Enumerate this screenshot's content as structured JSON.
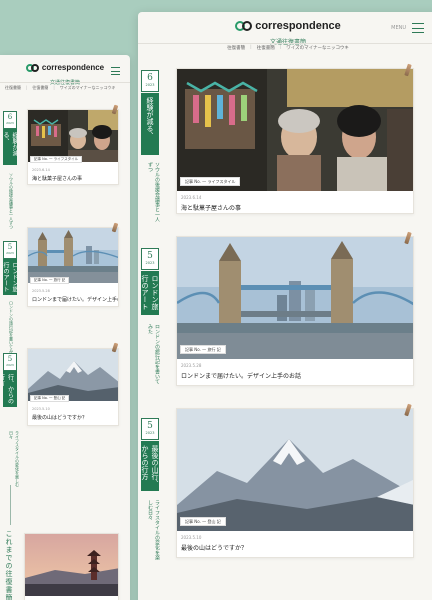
{
  "site": {
    "logo_text": "correspondence",
    "subtitle": "文通往復書簡",
    "menu_label": "MENU",
    "breadcrumb": [
      "往復書簡",
      "往復書簡",
      "ワイズのマイナーなニッコウキ"
    ]
  },
  "posts": [
    {
      "day": "6",
      "year": "2023",
      "category": "経験が減る、",
      "vertical_title": "ソウルの後援会議事と一人ずつ",
      "tags": "記事 No. 一 ライフスタイル",
      "date": "2023.6.14",
      "title": "海と駄菓子屋さんの事"
    },
    {
      "day": "5",
      "year": "2023",
      "category": "ロンドン旅行のアート",
      "vertical_title": "ロンドンの旅行記を書いてみた",
      "tags": "記事 No. 一 旅行 記",
      "date": "2023.5.28",
      "title": "ロンドンまで届けたい。デザイン上手のお話"
    },
    {
      "day": "5",
      "year": "2023",
      "category": "最後の山行、からの行方",
      "vertical_title": "ライフスタイルの変化を楽しむ日々",
      "tags": "記事 No. 一 登山 記",
      "date": "2023.5.10",
      "title": "最後の山はどうですか？"
    }
  ],
  "archive_label": "これまでの往復書簡",
  "colors": {
    "accent": "#237a52",
    "background": "#a9cdbe",
    "paper": "#f7f6f2"
  }
}
